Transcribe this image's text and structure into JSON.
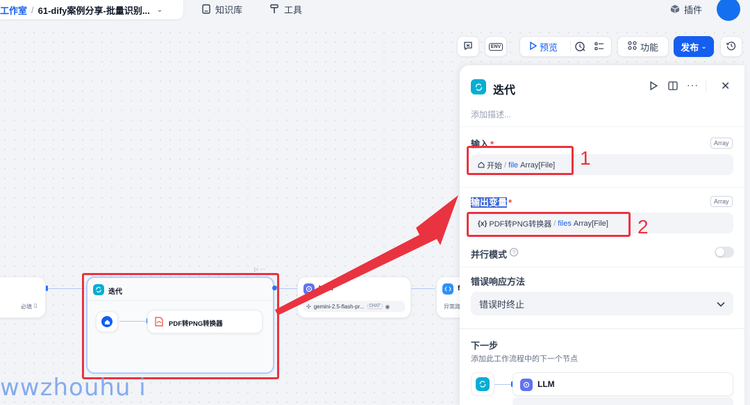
{
  "breadcrumb": {
    "studio": "工作室",
    "separator": "/",
    "app_name": "61-dify案例分享-批量识别..."
  },
  "nav": {
    "knowledge": "知识库",
    "tools": "工具",
    "plugins": "插件"
  },
  "toolbar": {
    "env": "ENV",
    "preview": "预览",
    "features": "功能",
    "publish": "发布"
  },
  "canvas": {
    "left_node_required": "必填",
    "iteration_node": {
      "title": "迭代",
      "child_title": "PDF转PNG转换器"
    },
    "llm_node": {
      "title": "LLM",
      "model": "gemini-2.5-flash-pr...",
      "mode_badge": "CHAT"
    },
    "code_node": {
      "title_initial": "f",
      "subtitle": "异策路"
    }
  },
  "panel": {
    "title": "迭代",
    "description_placeholder": "添加描述...",
    "input": {
      "label": "输入",
      "required_mark": "*",
      "type_badge": "Array",
      "source_node": "开始",
      "separator": "/",
      "var_name": "file",
      "var_type": "Array[File]"
    },
    "output": {
      "label": "输出变量",
      "required_mark": "*",
      "type_badge": "Array",
      "source_node": "PDF转PNG转换器",
      "separator": "/",
      "var_name": "files",
      "var_type": "Array[File]"
    },
    "parallel": {
      "label": "并行模式",
      "help_glyph": "?"
    },
    "error": {
      "label": "错误响应方法",
      "value": "错误时终止"
    },
    "next_step": {
      "label": "下一步",
      "description": "添加此工作流程中的下一个节点",
      "next_node": "LLM"
    }
  },
  "annotations": {
    "marker_1": "1",
    "marker_2": "2",
    "watermark": "wwzhouhu i"
  },
  "colors": {
    "accent": "#155eef",
    "annotation_red": "#ea3340",
    "iteration_icon": "#06aed4",
    "llm_icon": "#6172f3",
    "code_icon": "#2e90fa"
  }
}
